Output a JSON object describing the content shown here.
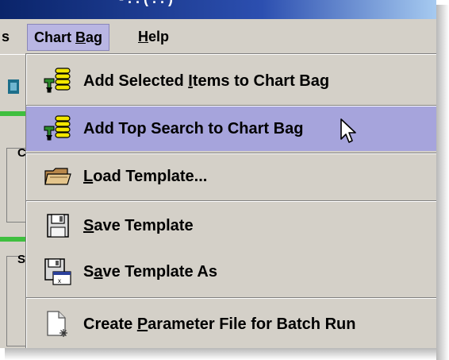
{
  "window": {
    "title": "- . . ( . . )"
  },
  "menubar": {
    "items": [
      {
        "label": "s"
      },
      {
        "label": "Chart Bag"
      },
      {
        "label": "Help"
      }
    ]
  },
  "dropdown": {
    "items": [
      {
        "label": "Add Selected Items to Chart Bag",
        "icon": "chart-bag-add-icon"
      },
      {
        "label": "Add Top Search to Chart Bag",
        "icon": "chart-bag-add-icon"
      },
      {
        "label": "Load Template...",
        "icon": "folder-icon"
      },
      {
        "label": "Save Template",
        "icon": "floppy-disk-icon"
      },
      {
        "label": "Save Template As",
        "icon": "floppy-disk-save-as-icon"
      },
      {
        "label": "Create Parameter File for Batch Run",
        "icon": "new-file-icon"
      }
    ]
  },
  "colors": {
    "highlight": "#a6a4dc",
    "menu_active": "#b9b6e3",
    "menu_bg": "#d4d0c8"
  }
}
